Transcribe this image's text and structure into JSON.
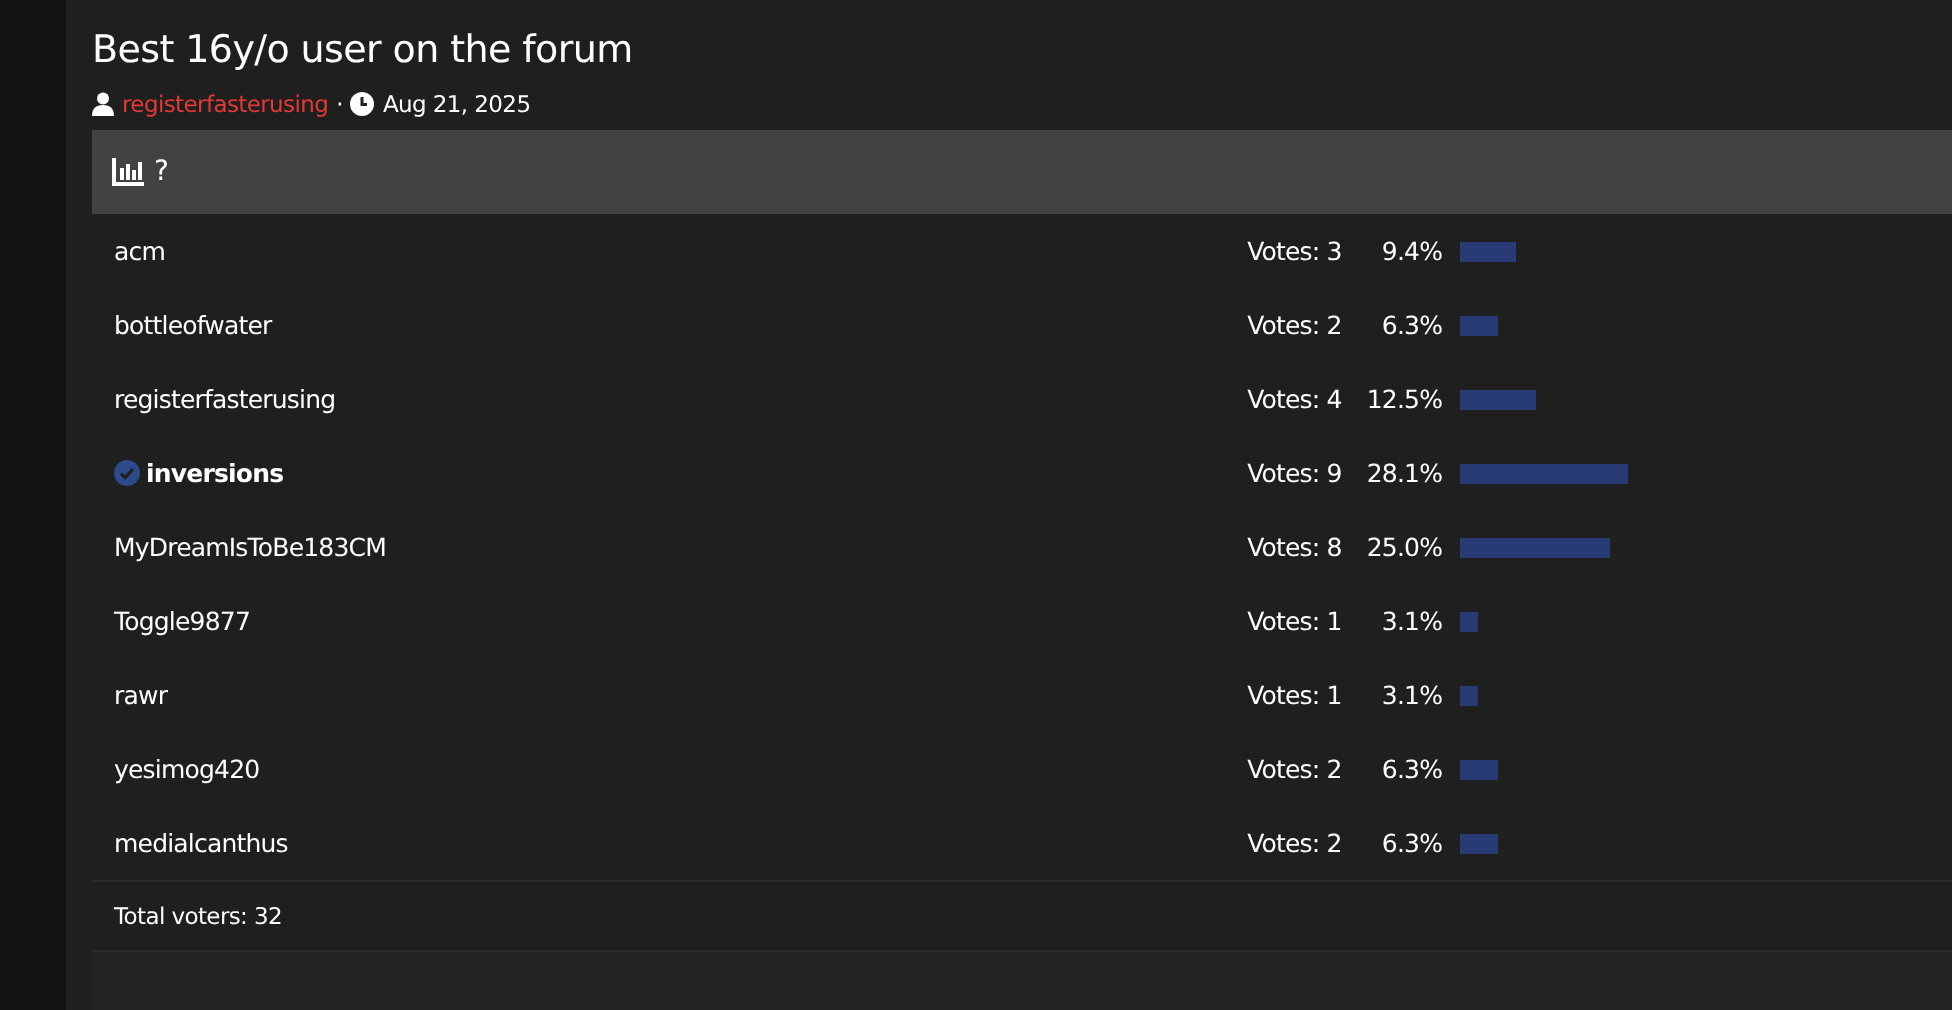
{
  "thread": {
    "title": "Best 16y/o user on the forum",
    "author": "registerfasterusing",
    "date": "Aug 21, 2025",
    "separator": "·"
  },
  "poll": {
    "question": "?",
    "options": [
      {
        "name": "acm",
        "verified": false,
        "votes": "Votes: 3",
        "percent": "9.4%"
      },
      {
        "name": "bottleofwater",
        "verified": false,
        "votes": "Votes: 2",
        "percent": "6.3%"
      },
      {
        "name": "registerfasterusing",
        "verified": false,
        "votes": "Votes: 4",
        "percent": "12.5%"
      },
      {
        "name": "inversions",
        "verified": true,
        "votes": "Votes: 9",
        "percent": "28.1%"
      },
      {
        "name": "MyDreamIsToBe183CM",
        "verified": false,
        "votes": "Votes: 8",
        "percent": "25.0%"
      },
      {
        "name": "Toggle9877",
        "verified": false,
        "votes": "Votes: 1",
        "percent": "3.1%"
      },
      {
        "name": "rawr",
        "verified": false,
        "votes": "Votes: 1",
        "percent": "3.1%"
      },
      {
        "name": "yesimog420",
        "verified": false,
        "votes": "Votes: 2",
        "percent": "6.3%"
      },
      {
        "name": "medialcanthus",
        "verified": false,
        "votes": "Votes: 2",
        "percent": "6.3%"
      }
    ],
    "total": "Total voters: 32"
  }
}
